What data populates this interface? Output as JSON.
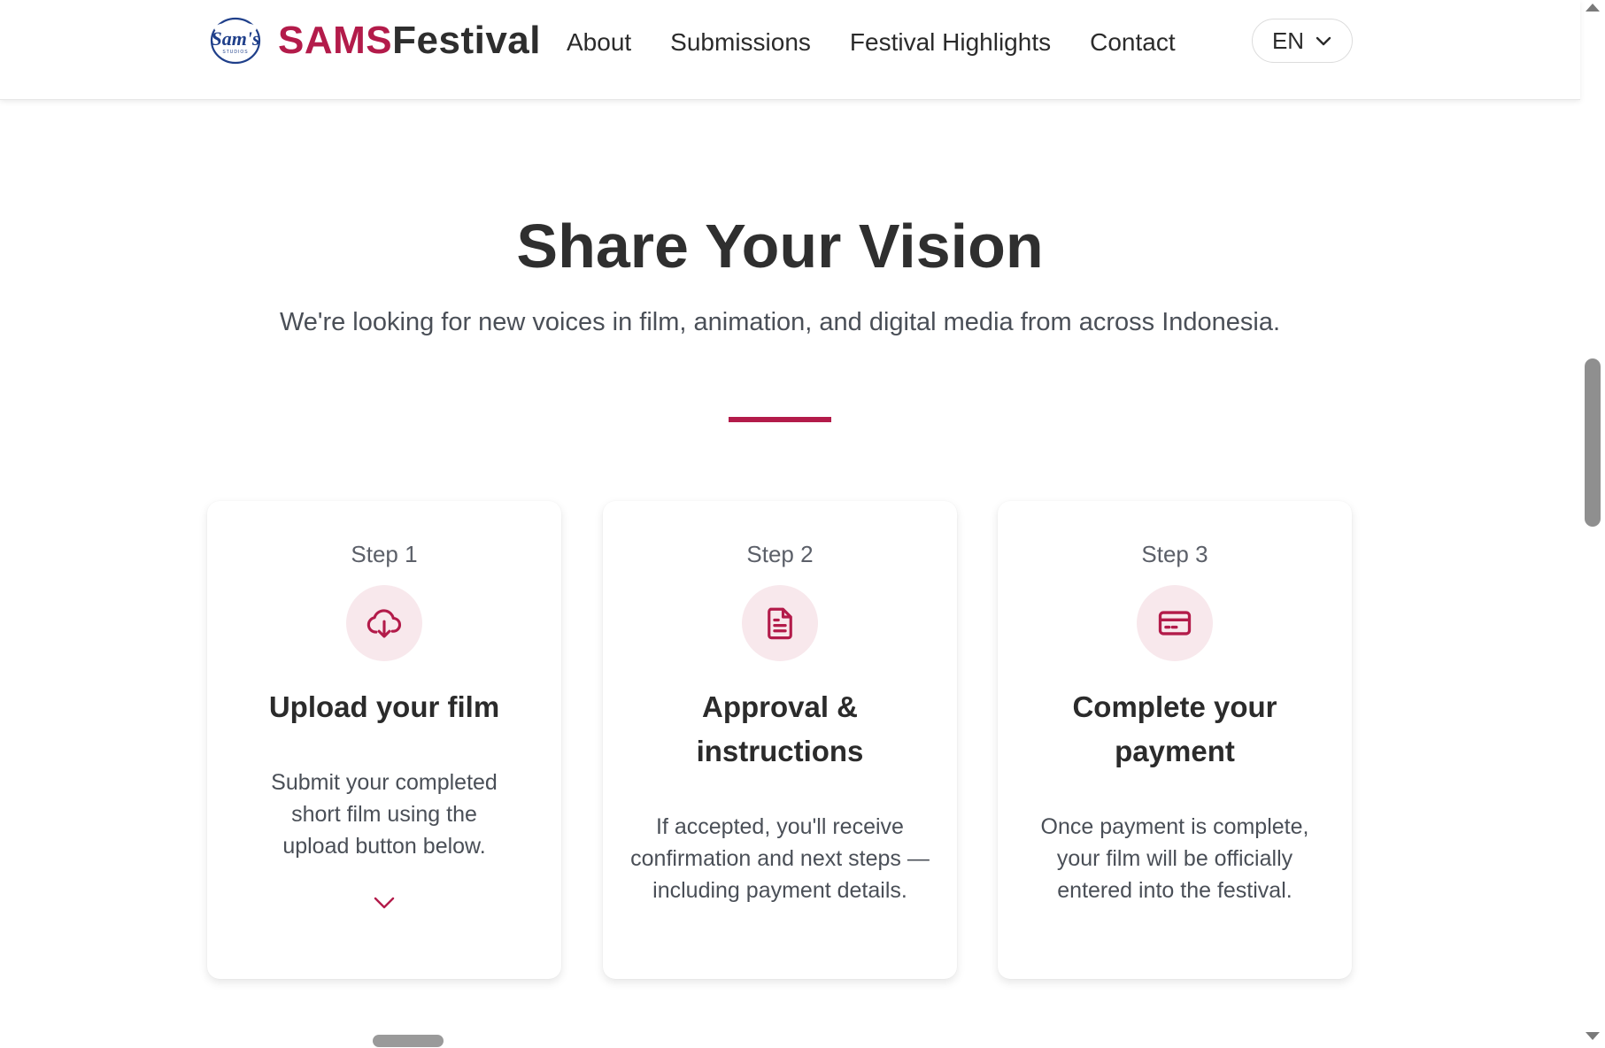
{
  "header": {
    "logo_text": "Sam's",
    "logo_subtext": "STUDIOS",
    "brand_part1": "SAMS",
    "brand_part2": "Festival",
    "nav": [
      {
        "label": "About"
      },
      {
        "label": "Submissions"
      },
      {
        "label": "Festival Highlights"
      },
      {
        "label": "Contact"
      }
    ],
    "language": {
      "selected": "EN",
      "icon": "chevron-down-icon"
    }
  },
  "hero": {
    "title": "Share Your Vision",
    "subtitle": "We're looking for new voices in film, animation, and digital media from across Indonesia."
  },
  "steps": [
    {
      "step_label": "Step 1",
      "icon": "cloud-download-icon",
      "title": "Upload your film",
      "text": "Submit your completed short film using the upload button below.",
      "action_icon": "chevron-down-icon"
    },
    {
      "step_label": "Step 2",
      "icon": "document-icon",
      "title": "Approval & instructions",
      "text": "If accepted, you'll receive confirmation and next steps — including payment details."
    },
    {
      "step_label": "Step 3",
      "icon": "credit-card-icon",
      "title": "Complete your payment",
      "text": "Once payment is complete, your film will be officially entered into the festival."
    }
  ],
  "colors": {
    "accent": "#b31b4a",
    "icon_bg": "#f8e8ec",
    "text_dark": "#2b2b2b",
    "text_muted": "#4a4f57"
  }
}
